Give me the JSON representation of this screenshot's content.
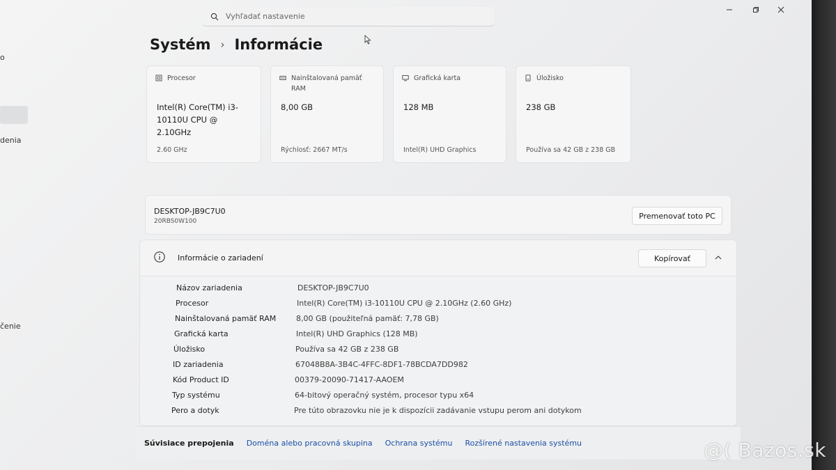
{
  "search": {
    "placeholder": "Vyhľadať nastavenie"
  },
  "sidebar_fragments": [
    "o",
    "denia",
    "čenie"
  ],
  "breadcrumb": {
    "parent": "Systém",
    "separator": "›",
    "current": "Informácie"
  },
  "cards": [
    {
      "icon": "processor-icon",
      "title": "Procesor",
      "value": "Intel(R) Core(TM) i3-10110U CPU @ 2.10GHz",
      "sub": "2.60 GHz"
    },
    {
      "icon": "ram-icon",
      "title": "Nainštalovaná pamäť RAM",
      "value": "8,00 GB",
      "sub": "Rýchlosť: 2667 MT/s"
    },
    {
      "icon": "graphics-card-icon",
      "title": "Grafická karta",
      "value": "128 MB",
      "sub": "Intel(R) UHD Graphics"
    },
    {
      "icon": "storage-icon",
      "title": "Úložisko",
      "value": "238 GB",
      "sub": "Používa sa 42 GB z 238 GB"
    }
  ],
  "device": {
    "name": "DESKTOP-JB9C7U0",
    "model": "20RBS0W100",
    "rename_button": "Premenovať toto PC"
  },
  "device_info": {
    "title": "Informácie o zariadení",
    "copy_button": "Kopírovať",
    "properties": [
      {
        "label": "Názov zariadenia",
        "value": "DESKTOP-JB9C7U0"
      },
      {
        "label": "Procesor",
        "value": "Intel(R) Core(TM) i3-10110U CPU @ 2.10GHz (2.60 GHz)"
      },
      {
        "label": "Nainštalovaná pamäť RAM",
        "value": "8,00 GB (použiteľná pamäť: 7,78 GB)"
      },
      {
        "label": "Grafická karta",
        "value": "Intel(R) UHD Graphics (128 MB)"
      },
      {
        "label": "Úložisko",
        "value": "Používa sa 42 GB z 238 GB"
      },
      {
        "label": "ID zariadenia",
        "value": "67048B8A-3B4C-4FFC-8DF1-78BCDA7DD982"
      },
      {
        "label": "Kód Product ID",
        "value": "00379-20090-71417-AAOEM"
      },
      {
        "label": "Typ systému",
        "value": "64-bitový operačný systém, procesor typu x64"
      },
      {
        "label": "Pero a dotyk",
        "value": "Pre túto obrazovku nie je k dispozícii zadávanie vstupu perom ani dotykom"
      }
    ]
  },
  "related": {
    "label": "Súvisiace prepojenia",
    "links": [
      "Doména alebo pracovná skupina",
      "Ochrana systému",
      "Rozšírené nastavenia systému"
    ]
  },
  "window_controls": [
    "minimize-icon",
    "restore-icon",
    "close-icon"
  ],
  "watermark": "@( Bazos.sk"
}
